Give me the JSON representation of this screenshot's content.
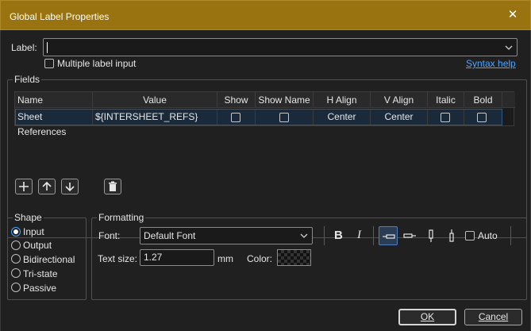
{
  "window": {
    "title": "Global Label Properties",
    "close_glyph": "✕"
  },
  "label": {
    "caption": "Label:",
    "value": "",
    "multiple_label_caption": "Multiple label input",
    "syntax_help": "Syntax help"
  },
  "fields": {
    "group_title": "Fields",
    "columns": [
      "Name",
      "Value",
      "Show",
      "Show Name",
      "H Align",
      "V Align",
      "Italic",
      "Bold"
    ],
    "rows": [
      {
        "name": "Sheet References",
        "value": "${INTERSHEET_REFS}",
        "show": false,
        "show_name": false,
        "h_align": "Center",
        "v_align": "Center",
        "italic": false,
        "bold": false
      }
    ]
  },
  "shape": {
    "group_title": "Shape",
    "options": [
      {
        "label": "Input",
        "selected": true
      },
      {
        "label": "Output",
        "selected": false
      },
      {
        "label": "Bidirectional",
        "selected": false
      },
      {
        "label": "Tri-state",
        "selected": false
      },
      {
        "label": "Passive",
        "selected": false
      }
    ]
  },
  "formatting": {
    "group_title": "Formatting",
    "font_caption": "Font:",
    "font_value": "Default Font",
    "bold_glyph": "B",
    "italic_glyph": "I",
    "auto_caption": "Auto",
    "text_size_caption": "Text size:",
    "text_size_value": "1.27",
    "text_size_unit": "mm",
    "color_caption": "Color:"
  },
  "buttons": {
    "ok": "OK",
    "cancel": "Cancel"
  },
  "colors": {
    "title_bar": "#99730f",
    "accent": "#4da3ff",
    "selection": "#1a2a3a"
  }
}
